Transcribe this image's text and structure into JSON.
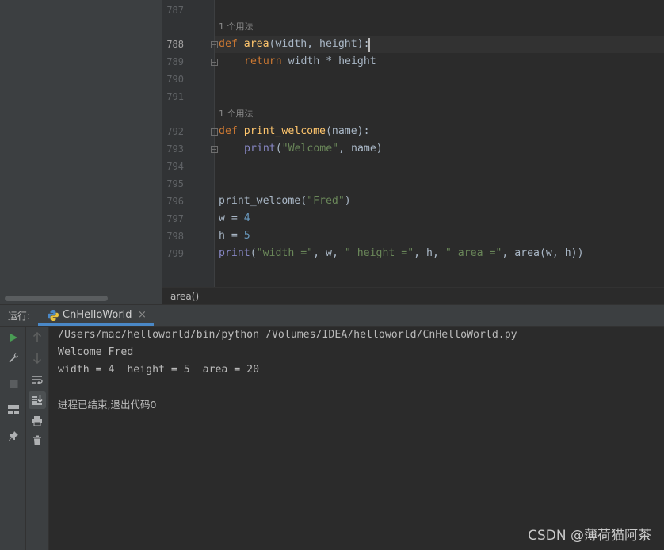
{
  "editor": {
    "hint_usage": "1 个用法",
    "lines": [
      {
        "num": "787"
      },
      {
        "num": "788",
        "active": true
      },
      {
        "num": "789"
      },
      {
        "num": "790"
      },
      {
        "num": "791"
      },
      {
        "num": "792"
      },
      {
        "num": "793"
      },
      {
        "num": "794"
      },
      {
        "num": "795"
      },
      {
        "num": "796"
      },
      {
        "num": "797"
      },
      {
        "num": "798"
      },
      {
        "num": "799"
      }
    ],
    "code": {
      "l788_kw": "def ",
      "l788_fn": "area",
      "l788_rest": "(width, height):",
      "l789_kw": "return ",
      "l789_rest": "width * height",
      "l792_kw": "def ",
      "l792_fn": "print_welcome",
      "l792_rest": "(name):",
      "l793_bi": "print",
      "l793_p1": "(",
      "l793_str": "\"Welcome\"",
      "l793_rest": ", name)",
      "l796_a": "print_welcome(",
      "l796_str": "\"Fred\"",
      "l796_b": ")",
      "l797_a": "w = ",
      "l797_num": "4",
      "l798_a": "h = ",
      "l798_num": "5",
      "l799_bi": "print",
      "l799_a": "(",
      "l799_s1": "\"width =\"",
      "l799_b": ", w, ",
      "l799_s2": "\" height =\"",
      "l799_c": ", h, ",
      "l799_s3": "\" area =\"",
      "l799_d": ", area(w, h))"
    },
    "breadcrumb": "area()"
  },
  "run": {
    "label": "运行:",
    "tab_label": "CnHelloWorld",
    "output": [
      "/Users/mac/helloworld/bin/python /Volumes/IDEA/helloworld/CnHelloWorld.py",
      "Welcome Fred",
      "width = 4  height = 5  area = 20",
      "",
      "进程已结束,退出代码0"
    ]
  },
  "watermark": "CSDN @薄荷猫阿茶",
  "colors": {
    "keyword": "#cc7832",
    "function": "#ffc66d",
    "builtin": "#8888c6",
    "string": "#6a8759",
    "number": "#6897bb",
    "run_green": "#499c54",
    "tab_accent": "#4a88c7"
  }
}
